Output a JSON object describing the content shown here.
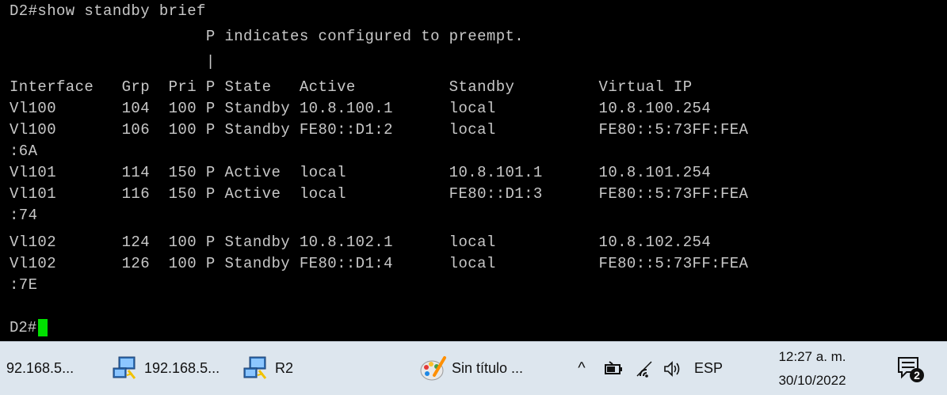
{
  "terminal": {
    "lines": [
      "D2#show standby brief",
      "                     P indicates configured to preempt.",
      "                     |",
      "Interface   Grp  Pri P State   Active          Standby         Virtual IP",
      "Vl100       104  100 P Standby 10.8.100.1      local           10.8.100.254",
      "Vl100       106  100 P Standby FE80::D1:2      local           FE80::5:73FF:FEA",
      ":6A",
      "Vl101       114  150 P Active  local           10.8.101.1      10.8.101.254",
      "Vl101       116  150 P Active  local           FE80::D1:3      FE80::5:73FF:FEA",
      ":74",
      "Vl102       124  100 P Standby 10.8.102.1      local           10.8.102.254",
      "Vl102       126  100 P Standby FE80::D1:4      local           FE80::5:73FF:FEA",
      ":7E"
    ],
    "prompt": "D2#",
    "colors": {
      "background": "#000000",
      "text": "#c8c8c8",
      "cursor": "#00e000"
    }
  },
  "taskbar": {
    "items": [
      {
        "label": "92.168.5...",
        "icon": ""
      },
      {
        "label": "192.168.5...",
        "icon": "network-computer-icon"
      },
      {
        "label": "R2",
        "icon": "network-computer-icon"
      },
      {
        "label": "Sin título ...",
        "icon": "paint-icon"
      }
    ],
    "tray": {
      "chevron": "^",
      "icons": [
        "battery-icon",
        "wifi-icon",
        "speaker-icon"
      ],
      "language": "ESP"
    },
    "clock": {
      "time": "12:27 a. m.",
      "date": "30/10/2022"
    },
    "notifications": {
      "count": "2",
      "icon": "notification-icon"
    },
    "colors": {
      "background": "#dde6ee"
    }
  }
}
